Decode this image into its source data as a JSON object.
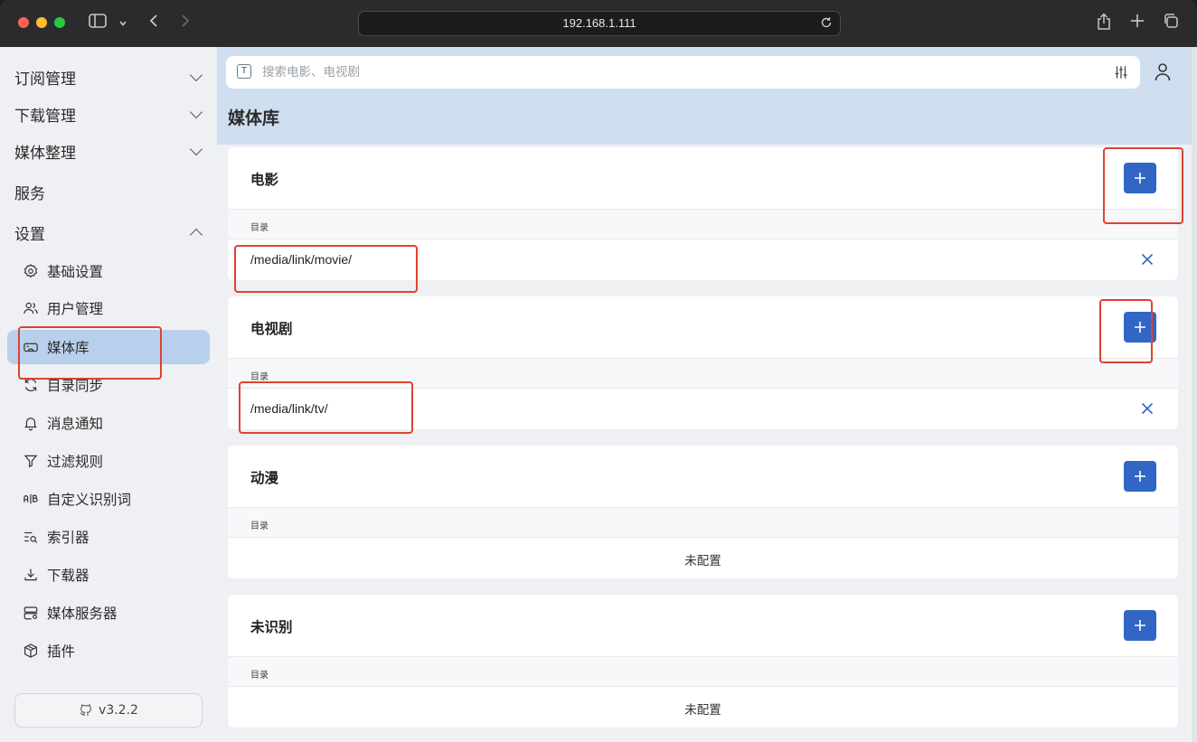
{
  "browser": {
    "address": "192.168.1.111"
  },
  "search": {
    "placeholder": "搜索电影、电视剧"
  },
  "sidebar": {
    "groups": [
      {
        "label": "订阅管理"
      },
      {
        "label": "下载管理"
      },
      {
        "label": "媒体整理"
      },
      {
        "label": "服务"
      },
      {
        "label": "设置"
      }
    ],
    "items": [
      {
        "label": "基础设置",
        "icon": "gear-icon"
      },
      {
        "label": "用户管理",
        "icon": "users-icon"
      },
      {
        "label": "媒体库",
        "icon": "vr-icon"
      },
      {
        "label": "目录同步",
        "icon": "sync-icon"
      },
      {
        "label": "消息通知",
        "icon": "bell-icon"
      },
      {
        "label": "过滤规则",
        "icon": "filter-icon"
      },
      {
        "label": "自定义识别词",
        "icon": "ab-icon"
      },
      {
        "label": "索引器",
        "icon": "list-search-icon"
      },
      {
        "label": "下载器",
        "icon": "download-icon"
      },
      {
        "label": "媒体服务器",
        "icon": "server-icon"
      },
      {
        "label": "插件",
        "icon": "box-icon"
      }
    ],
    "version": "v3.2.2"
  },
  "page": {
    "title": "媒体库"
  },
  "libraries": [
    {
      "title": "电影",
      "dir_header": "目录",
      "path": "/media/link/movie/"
    },
    {
      "title": "电视剧",
      "dir_header": "目录",
      "path": "/media/link/tv/"
    },
    {
      "title": "动漫",
      "dir_header": "目录",
      "empty": "未配置"
    },
    {
      "title": "未识别",
      "dir_header": "目录",
      "empty": "未配置"
    }
  ],
  "colors": {
    "accent": "#3166c5",
    "active_nav": "#b9d0ec",
    "header_band": "#cfdff0",
    "annotation": "#e0422f"
  }
}
